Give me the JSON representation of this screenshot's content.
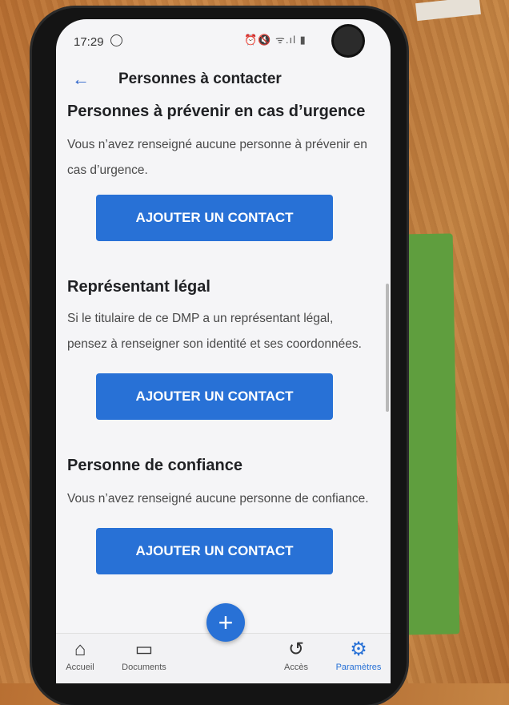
{
  "status_bar": {
    "time": "17:29",
    "icons": "⏰🔇 ᯤ.ıl ▮"
  },
  "app_bar": {
    "back_icon": "arrow-left-icon",
    "title": "Personnes à contacter"
  },
  "sections": [
    {
      "title": "Personnes à prévenir en cas d’urgence",
      "text": "Vous n’avez renseigné aucune personne à prévenir en cas d’urgence.",
      "button": "AJOUTER UN CONTACT"
    },
    {
      "title": "Représentant légal",
      "text": "Si le titulaire de ce DMP a un représentant légal, pensez à renseigner son identité et ses coordonnées.",
      "button": "AJOUTER UN CONTACT"
    },
    {
      "title": "Personne de confiance",
      "text": "Vous n’avez renseigné aucune personne de confiance.",
      "button": "AJOUTER UN CONTACT"
    }
  ],
  "bottom_nav": {
    "fab": "+",
    "items": [
      {
        "label": "Accueil",
        "icon": "home-icon"
      },
      {
        "label": "Documents",
        "icon": "folder-icon"
      },
      {
        "label": "Accès",
        "icon": "history-icon"
      },
      {
        "label": "Paramètres",
        "icon": "gear-icon",
        "active": true
      }
    ]
  },
  "colors": {
    "accent": "#2871d6",
    "background": "#f5f5f7"
  }
}
